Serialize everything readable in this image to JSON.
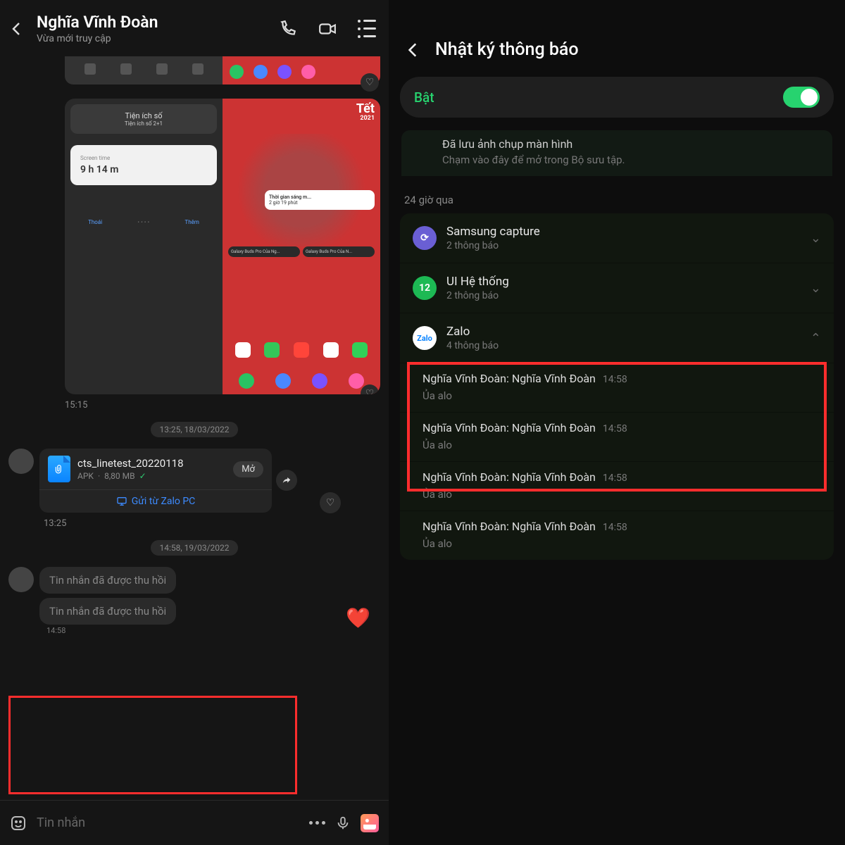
{
  "left": {
    "header": {
      "title": "Nghĩa Vĩnh Đoàn",
      "subtitle": "Vừa mới truy cập"
    },
    "img1_time": "15:15",
    "widget": {
      "title": "Tiện ích số",
      "sub": "Tiện ích số  2+1",
      "screen": "Screen time",
      "st_val": "9 h 14 m"
    },
    "bigred": {
      "tet": "Tết",
      "tetyear": "2021",
      "w_title": "Thời gian sáng m...",
      "w_val": "2 giờ 19 phút",
      "buds1": "Galaxy Buds Pro Của Ng...",
      "buds2": "Galaxy Buds Pro Của N..."
    },
    "date1": "13:25, 18/03/2022",
    "file": {
      "name": "cts_linetest_20220118",
      "meta_type": "APK",
      "meta_size": "8,80 MB",
      "open": "Mở",
      "from": "Gửi từ Zalo PC"
    },
    "file_time": "13:25",
    "date2": "14:58, 19/03/2022",
    "recalled_text": "Tin nhắn đã được thu hồi",
    "recalled_time": "14:58",
    "composer_placeholder": "Tin nhắn"
  },
  "right": {
    "title": "Nhật ký thông báo",
    "toggle": "Bật",
    "capture": {
      "line1": "Đã lưu ảnh chụp màn hình",
      "line2": "Chạm vào đây để mở trong Bộ sưu tập."
    },
    "section": "24 giờ qua",
    "groups": [
      {
        "name": "Samsung capture",
        "sub": "2 thông báo"
      },
      {
        "name": "UI Hệ thống",
        "sub": "2 thông báo"
      },
      {
        "name": "Zalo",
        "sub": "4 thông báo"
      }
    ],
    "noti": {
      "title": "Nghĩa Vĩnh Đoàn: Nghĩa Vĩnh Đoàn",
      "time": "14:58",
      "body": "Ủa alo"
    }
  }
}
